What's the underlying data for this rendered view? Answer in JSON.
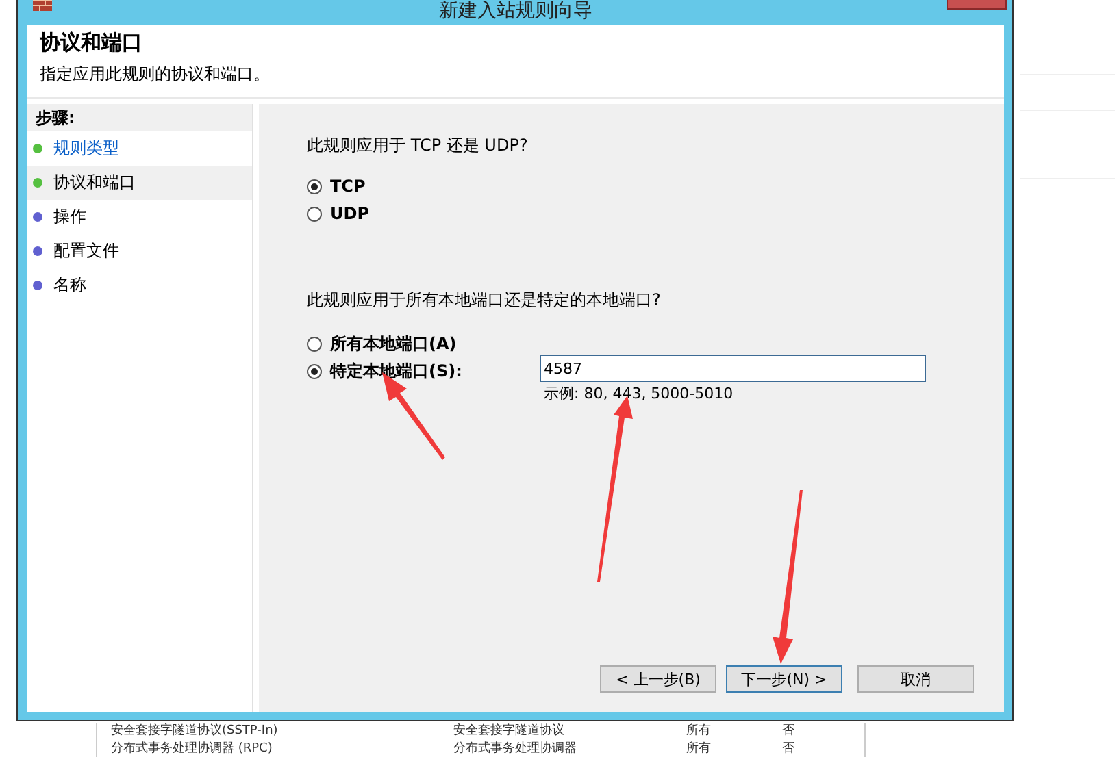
{
  "window": {
    "title": "新建入站规则向导"
  },
  "header": {
    "title": "协议和端口",
    "subtitle": "指定应用此规则的协议和端口。"
  },
  "steps": {
    "heading": "步骤:",
    "items": [
      {
        "label": "规则类型",
        "completed": true,
        "link": true,
        "selected": false
      },
      {
        "label": "协议和端口",
        "completed": true,
        "link": false,
        "selected": true
      },
      {
        "label": "操作",
        "completed": false,
        "link": false,
        "selected": false
      },
      {
        "label": "配置文件",
        "completed": false,
        "link": false,
        "selected": false
      },
      {
        "label": "名称",
        "completed": false,
        "link": false,
        "selected": false
      }
    ]
  },
  "protocol": {
    "question": "此规则应用于 TCP 还是 UDP?",
    "options": [
      {
        "label": "TCP",
        "selected": true
      },
      {
        "label": "UDP",
        "selected": false
      }
    ]
  },
  "ports": {
    "question": "此规则应用于所有本地端口还是特定的本地端口?",
    "options": [
      {
        "label": "所有本地端口(A)",
        "selected": false
      },
      {
        "label": "特定本地端口(S):",
        "selected": true
      }
    ],
    "value": "4587",
    "hint": "示例: 80, 443, 5000-5010"
  },
  "buttons": [
    {
      "label": "< 上一步(B)",
      "default": false
    },
    {
      "label": "下一步(N) >",
      "default": true
    },
    {
      "label": "取消",
      "default": false
    }
  ],
  "background_list": {
    "rows": [
      {
        "cells": [
          "安全套接字隧道协议(SSTP-In)",
          "安全套接字隧道协议",
          "所有",
          "否"
        ]
      },
      {
        "cells": [
          "分布式事务处理协调器 (RPC)",
          "分布式事务处理协调器",
          "所有",
          "否"
        ]
      }
    ]
  }
}
